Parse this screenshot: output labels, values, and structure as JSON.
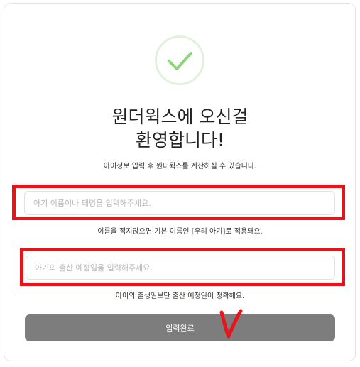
{
  "welcome": {
    "title_line1": "원더윅스에 오신걸",
    "title_line2": "환영합니다!",
    "subtitle": "아이정보 입력 후 원더윅스를 계산하실 수 있습니다."
  },
  "form": {
    "name_placeholder": "아기 이름이나 태명을 입력해주세요.",
    "name_value": "",
    "name_hint": "이름을 적지않으면 기본 이름인 [우리 아기]로 적용돼요.",
    "date_placeholder": "아기의 출산 예정일을 입력해주세요.",
    "date_value": "",
    "date_hint": "아이의 출생일보단 출산 예정일이 정확해요.",
    "submit_label": "입력완료"
  },
  "colors": {
    "annotation": "#e8141b",
    "check": "#8ed27c",
    "button": "#7d7d7d"
  },
  "icons": {
    "success": "checkmark-icon",
    "annotation_mark": "handwritten-check-icon"
  }
}
